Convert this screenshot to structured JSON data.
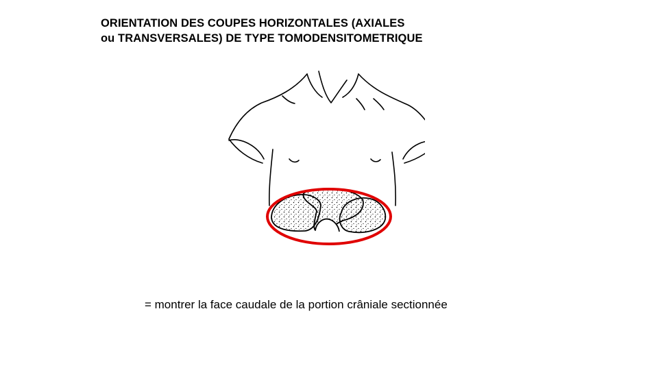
{
  "slide": {
    "title_line1": "ORIENTATION DES COUPES HORIZONTALES (AXIALES",
    "title_line2": "ou TRANSVERSALES)  DE TYPE TOMODENSITOMETRIQUE",
    "caption": "= montrer la face caudale de la portion crâniale sectionnée"
  },
  "colors": {
    "outline": "#000000",
    "highlight_ring": "#e00000",
    "background": "#ffffff"
  }
}
